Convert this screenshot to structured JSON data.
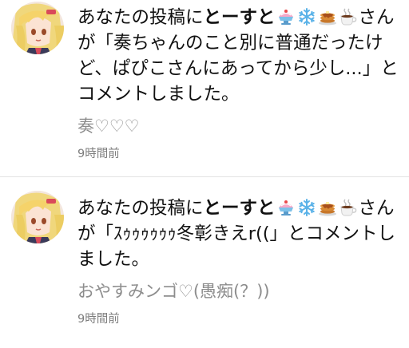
{
  "notifications": [
    {
      "prefix": "あなたの投稿に",
      "user_name": "とーすと",
      "badges": [
        "shaved-ice-icon",
        "snowflake-icon",
        "pancakes-icon",
        "hot-beverage-icon"
      ],
      "message": "さんが「奏ちゃんのこと別に普通だったけど、ぱぴこさんにあってから少し...」とコメントしました。",
      "comment": "奏♡♡♡",
      "time": "9時間前"
    },
    {
      "prefix": "あなたの投稿に",
      "user_name": "とーすと",
      "badges": [
        "shaved-ice-icon",
        "snowflake-icon",
        "pancakes-icon",
        "hot-beverage-icon"
      ],
      "message": "さんが「ｽｩｩｩｩｩｩ冬彰きえr((」とコメントしました。",
      "comment": "おやすみンゴ♡(愚痴(？))",
      "time": "9時間前"
    }
  ]
}
